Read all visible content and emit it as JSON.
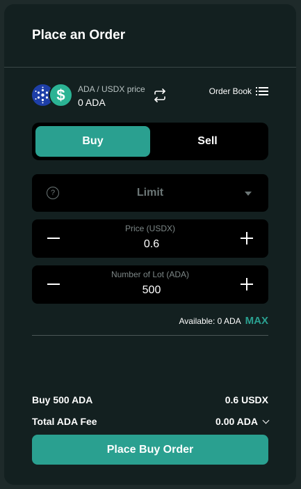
{
  "header": {
    "title": "Place an Order"
  },
  "pair": {
    "label": "ADA / USDX price",
    "price": "0 ADA",
    "order_book_label": "Order Book",
    "base_icon": "cardano-icon",
    "quote_icon": "usdx-dollar-icon",
    "quote_symbol": "$"
  },
  "side_toggle": {
    "buy": "Buy",
    "sell": "Sell",
    "active": "buy"
  },
  "order_type": {
    "selected": "Limit"
  },
  "price_field": {
    "label": "Price (USDX)",
    "value": "0.6"
  },
  "lot_field": {
    "label": "Number of Lot (ADA)",
    "value": "500"
  },
  "available": {
    "text": "Available: 0 ADA",
    "max": "MAX"
  },
  "summary": {
    "buy_label": "Buy 500 ADA",
    "buy_value": "0.6 USDX",
    "fee_label": "Total ADA Fee",
    "fee_value": "0.00 ADA"
  },
  "cta": {
    "label": "Place Buy Order"
  },
  "colors": {
    "accent": "#2aa090",
    "panel": "#132020",
    "field": "#000000"
  }
}
